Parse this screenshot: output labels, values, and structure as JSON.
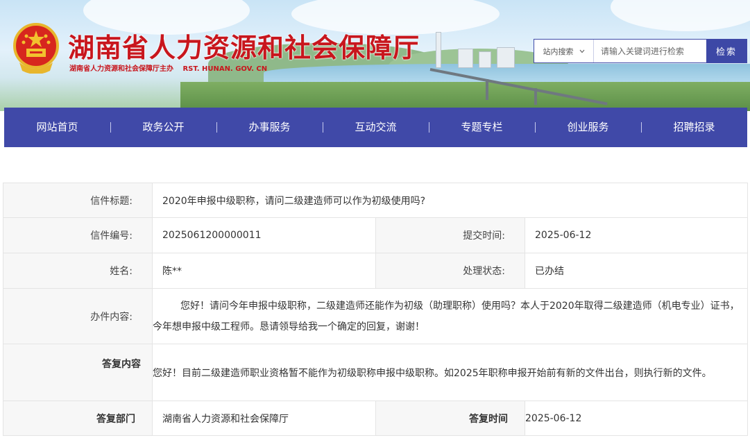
{
  "header": {
    "site_title": "湖南省人力资源和社会保障厅",
    "sponsor": "湖南省人力资源和社会保障厅主办",
    "domain": "RST. HUNAN. GOV. CN",
    "search": {
      "scope": "站内搜索",
      "placeholder": "请输入关键词进行检索",
      "button": "检索"
    }
  },
  "nav": {
    "items": [
      "网站首页",
      "政务公开",
      "办事服务",
      "互动交流",
      "专题专栏",
      "创业服务",
      "招聘招录"
    ]
  },
  "letter": {
    "title_label": "信件标题:",
    "title": "2020年申报中级职称，请问二级建造师可以作为初级使用吗?",
    "number_label": "信件编号:",
    "number": "2025061200000011",
    "submit_time_label": "提交时间:",
    "submit_time": "2025-06-12",
    "name_label": "姓名:",
    "name": "陈**",
    "status_label": "处理状态:",
    "status": "已办结",
    "content_label": "办件内容:",
    "content": "您好！请问今年申报中级职称，二级建造师还能作为初级（助理职称）使用吗？本人于2020年取得二级建造师（机电专业）证书，今年想申报中级工程师。恳请领导给我一个确定的回复，谢谢！",
    "reply_label": "答复内容",
    "reply": "您好！目前二级建造师职业资格暂不能作为初级职称申报中级职称。如2025年职称申报开始前有新的文件出台，则执行新的文件。",
    "reply_dept_label": "答复部门",
    "reply_dept": "湖南省人力资源和社会保障厅",
    "reply_time_label": "答复时间",
    "reply_time": "2025-06-12"
  },
  "colors": {
    "brand_red": "#c8161d",
    "nav_blue": "#4049a8"
  }
}
